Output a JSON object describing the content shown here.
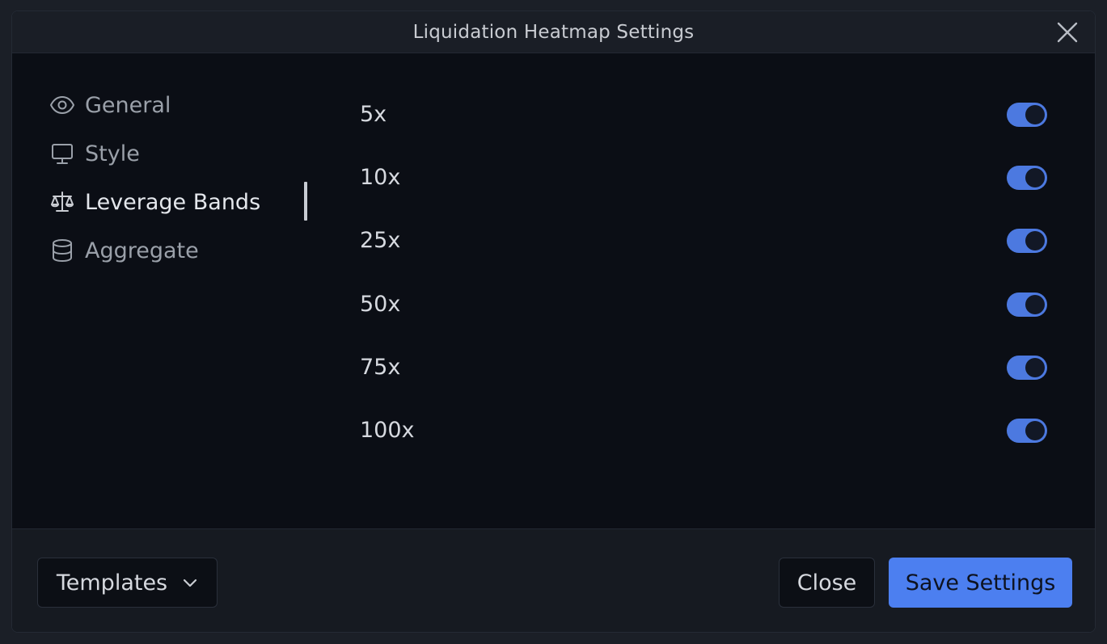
{
  "dialog": {
    "title": "Liquidation Heatmap Settings",
    "close_icon": "close-icon"
  },
  "sidebar": {
    "items": [
      {
        "label": "General",
        "icon": "eye-icon",
        "active": false
      },
      {
        "label": "Style",
        "icon": "monitor-icon",
        "active": false
      },
      {
        "label": "Leverage Bands",
        "icon": "scale-icon",
        "active": true
      },
      {
        "label": "Aggregate",
        "icon": "database-icon",
        "active": false
      }
    ]
  },
  "leverage_bands": [
    {
      "label": "5x",
      "enabled": true
    },
    {
      "label": "10x",
      "enabled": true
    },
    {
      "label": "25x",
      "enabled": true
    },
    {
      "label": "50x",
      "enabled": true
    },
    {
      "label": "75x",
      "enabled": true
    },
    {
      "label": "100x",
      "enabled": true
    }
  ],
  "footer": {
    "templates_label": "Templates",
    "close_label": "Close",
    "save_label": "Save Settings"
  },
  "colors": {
    "accent": "#4c7ff0",
    "toggle_on": "#4c79e0",
    "background": "#0b0e15"
  }
}
